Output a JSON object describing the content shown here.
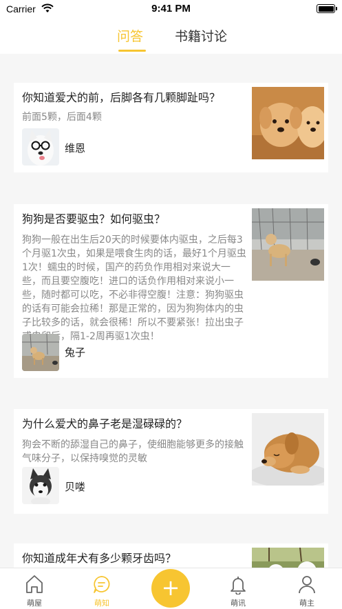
{
  "status": {
    "carrier": "Carrier",
    "time": "9:41 PM"
  },
  "tabs": [
    {
      "label": "问答",
      "active": true
    },
    {
      "label": "书籍讨论",
      "active": false
    }
  ],
  "posts": [
    {
      "title": "你知道爱犬的前，后脚各有几颗脚趾吗？",
      "excerpt": "前面5颗，后面4颗",
      "author": "维恩",
      "thumbnail_icon": "golden-retriever-puppies-photo",
      "avatar_icon": "husky-with-glasses-photo"
    },
    {
      "title": "狗狗是否要驱虫？如何驱虫？",
      "excerpt": "狗狗一般在出生后20天的时候要体内驱虫，之后每3个月驱1次虫，如果是喂食生肉的话，最好1个月驱虫1次！蠕虫的时候，国产的药负作用相对来说大一些，而且要空腹吃！进口的话负作用相对来说小一些，随时都可以吃，不必非得空腹！注意：狗狗驱虫的话有可能会拉稀！那是正常的，因为狗狗体内的虫子比较多的话，就会很稀！所以不要紧张！拉出虫子或虫卵后，隔1-2周再驱1次虫！",
      "author": "兔子",
      "thumbnail_icon": "dog-in-yard-photo",
      "avatar_icon": "dog-in-yard-avatar"
    },
    {
      "title": "为什么爱犬的鼻子老是湿碌碌的？",
      "excerpt": "狗会不断的舔湿自己的鼻子，使细胞能够更多的接触气味分子，以保持嗅觉的灵敏",
      "author": "贝喽",
      "thumbnail_icon": "sleeping-puppy-photo",
      "avatar_icon": "husky-puppy-avatar"
    },
    {
      "title": "你知道成年犬有多少颗牙齿吗？",
      "thumbnail_icon": "white-dog-on-grass-photo"
    }
  ],
  "tabbar": {
    "items": [
      {
        "label": "萌屋",
        "icon": "house-icon",
        "active": false
      },
      {
        "label": "萌知",
        "icon": "chat-bubble-icon",
        "active": true
      },
      {
        "label": "萌讯",
        "icon": "bell-icon",
        "active": false
      },
      {
        "label": "萌主",
        "icon": "person-icon",
        "active": false
      }
    ],
    "fab_icon": "plus-icon",
    "fab_label": "+"
  },
  "colors": {
    "accent": "#f7c531",
    "background": "#f6f6f6",
    "muted_text": "#888888"
  }
}
